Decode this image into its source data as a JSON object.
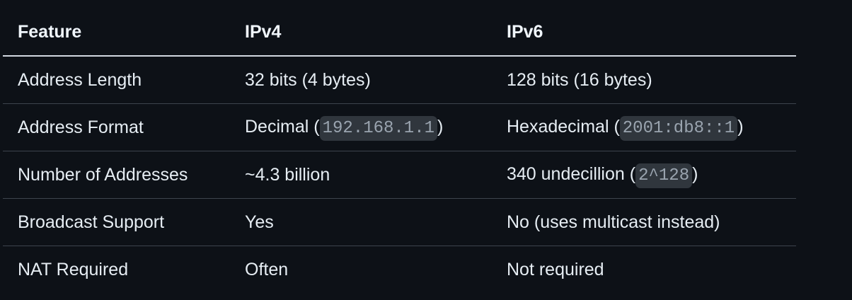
{
  "table": {
    "headers": [
      "Feature",
      "IPv4",
      "IPv6"
    ],
    "rows": [
      {
        "feature": "Address Length",
        "ipv4": {
          "text": "32 bits (4 bytes)"
        },
        "ipv6": {
          "text": "128 bits (16 bytes)"
        }
      },
      {
        "feature": "Address Format",
        "ipv4": {
          "prefix": "Decimal (",
          "code": "192.168.1.1",
          "suffix": ")"
        },
        "ipv6": {
          "prefix": "Hexadecimal (",
          "code": "2001:db8::1",
          "suffix": ")"
        }
      },
      {
        "feature": "Number of Addresses",
        "ipv4": {
          "text": "~4.3 billion"
        },
        "ipv6": {
          "prefix": "340 undecillion (",
          "code": "2^128",
          "suffix": ")"
        }
      },
      {
        "feature": "Broadcast Support",
        "ipv4": {
          "text": "Yes"
        },
        "ipv6": {
          "text": "No (uses multicast instead)"
        }
      },
      {
        "feature": "NAT Required",
        "ipv4": {
          "text": "Often"
        },
        "ipv6": {
          "text": "Not required"
        }
      }
    ]
  },
  "colors": {
    "background": "#0d1117",
    "text": "#e6edf3",
    "header_border": "#d1d7e0",
    "row_border": "#3d444d",
    "code_background": "#30363d",
    "code_text": "#9aa4af"
  }
}
